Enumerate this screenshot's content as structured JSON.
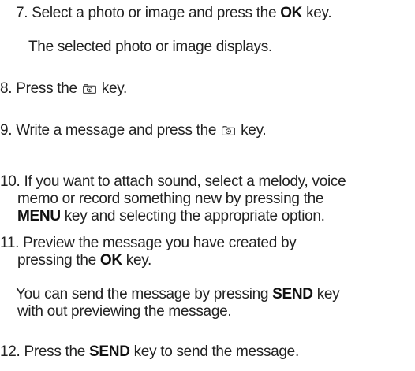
{
  "steps": [
    {
      "lead": "7. Select a photo or image and press the ",
      "key": "OK",
      "tail": " key."
    },
    {
      "note": "The selected photo or image displays."
    },
    {
      "lead": "8. Press the ",
      "icon": "camera-key-icon",
      "tail": " key."
    },
    {
      "lead": "9. Write a message and press the ",
      "icon": "camera-key-icon",
      "tail": " key."
    },
    {
      "line1": "10. If you want to attach sound, select a melody, voice",
      "line2": "memo or record something new by pressing the",
      "key": "MENU",
      "line3_tail": " key and selecting the appropriate option."
    },
    {
      "line1": "11. Preview the message you have created by",
      "line2_lead": "pressing the ",
      "key": "OK",
      "line2_tail": " key."
    },
    {
      "line1_lead": "You can send the message by pressing ",
      "key": "SEND",
      "line1_tail": " key",
      "line2": "with out previewing the message."
    },
    {
      "lead": "12. Press the ",
      "key": "SEND",
      "tail": " key to send the message."
    }
  ],
  "icons": {
    "camera_key": "camera-key-icon"
  },
  "colors": {
    "text": "#222222",
    "background": "#ffffff"
  }
}
